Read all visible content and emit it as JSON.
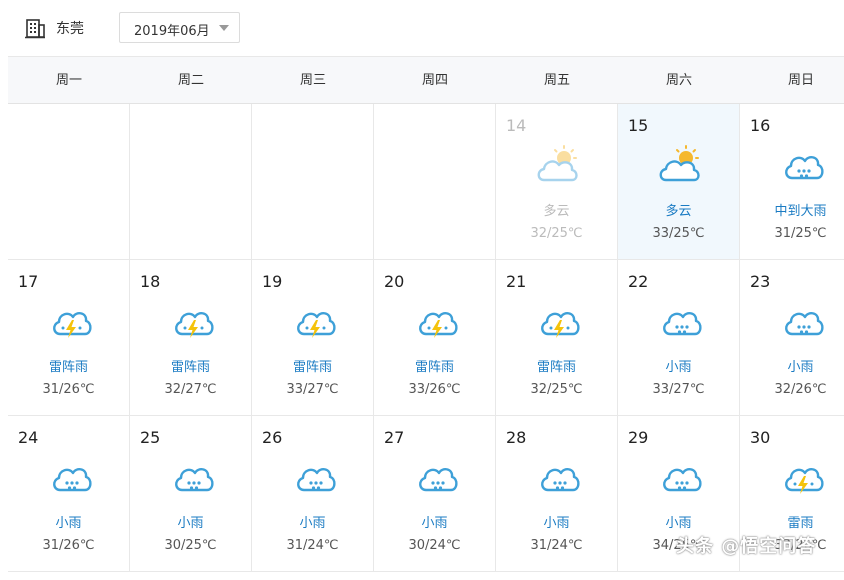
{
  "header": {
    "city": "东莞",
    "month": "2019年06月"
  },
  "weekdays": [
    "周一",
    "周二",
    "周三",
    "周四",
    "周五",
    "周六",
    "周日"
  ],
  "days": [
    null,
    null,
    null,
    null,
    {
      "date": "14",
      "icon": "partly-cloudy-icon",
      "desc": "多云",
      "temp": "32/25℃",
      "state": "past"
    },
    {
      "date": "15",
      "icon": "partly-cloudy-icon",
      "desc": "多云",
      "temp": "33/25℃",
      "state": "today"
    },
    {
      "date": "16",
      "icon": "rain-icon",
      "desc": "中到大雨",
      "temp": "31/25℃"
    },
    {
      "date": "17",
      "icon": "thunderstorm-icon",
      "desc": "雷阵雨",
      "temp": "31/26℃"
    },
    {
      "date": "18",
      "icon": "thunderstorm-icon",
      "desc": "雷阵雨",
      "temp": "32/27℃"
    },
    {
      "date": "19",
      "icon": "thunderstorm-icon",
      "desc": "雷阵雨",
      "temp": "33/27℃"
    },
    {
      "date": "20",
      "icon": "thunderstorm-icon",
      "desc": "雷阵雨",
      "temp": "33/26℃"
    },
    {
      "date": "21",
      "icon": "thunderstorm-icon",
      "desc": "雷阵雨",
      "temp": "32/25℃"
    },
    {
      "date": "22",
      "icon": "rain-icon",
      "desc": "小雨",
      "temp": "33/27℃"
    },
    {
      "date": "23",
      "icon": "rain-icon",
      "desc": "小雨",
      "temp": "32/26℃"
    },
    {
      "date": "24",
      "icon": "rain-icon",
      "desc": "小雨",
      "temp": "31/26℃"
    },
    {
      "date": "25",
      "icon": "rain-icon",
      "desc": "小雨",
      "temp": "30/25℃"
    },
    {
      "date": "26",
      "icon": "rain-icon",
      "desc": "小雨",
      "temp": "31/24℃"
    },
    {
      "date": "27",
      "icon": "rain-icon",
      "desc": "小雨",
      "temp": "30/24℃"
    },
    {
      "date": "28",
      "icon": "rain-icon",
      "desc": "小雨",
      "temp": "31/24℃"
    },
    {
      "date": "29",
      "icon": "rain-icon",
      "desc": "小雨",
      "temp": "34/25℃"
    },
    {
      "date": "30",
      "icon": "thunderstorm-icon",
      "desc": "雷雨",
      "temp": "33/26℃"
    }
  ],
  "watermark": "头条 @悟空问答",
  "colors": {
    "desc_text": "#1a7bc3",
    "cloud_stroke": "#3ea0d8",
    "sun": "#f5b82e",
    "bolt": "#f5c30a",
    "today_bg": "#f1f8fd"
  }
}
